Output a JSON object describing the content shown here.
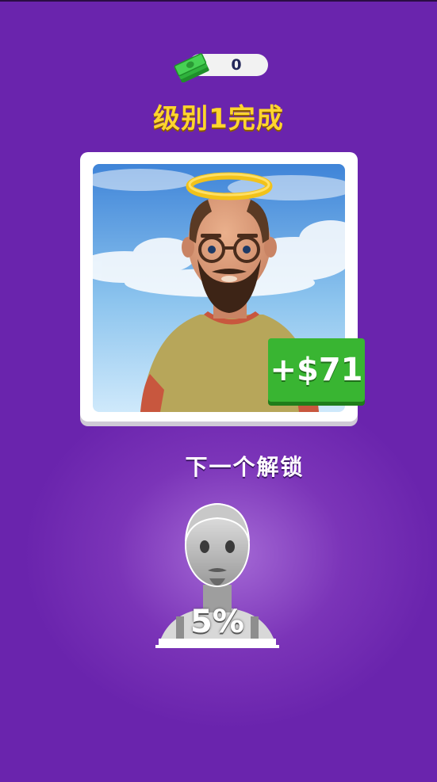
{
  "currency": {
    "icon": "cash-stack-icon",
    "amount": "0"
  },
  "title": "级别1完成",
  "reward": {
    "amount_label": "+$71"
  },
  "next_unlock": {
    "label": "下一个解锁",
    "progress_label": "5%",
    "progress": 0.05
  },
  "colors": {
    "background": "#6a24ad",
    "title": "#ffd52e",
    "reward_green": "#39b532"
  }
}
